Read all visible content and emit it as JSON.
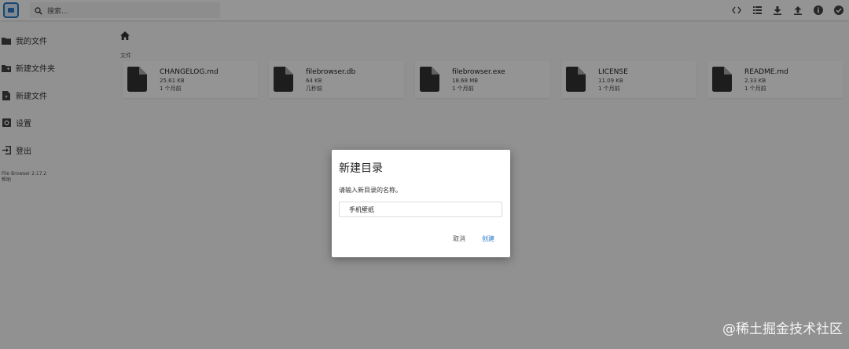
{
  "header": {
    "logo_icon": "file-browser-logo",
    "search_placeholder": "搜索...",
    "actions": [
      {
        "icon": "code-icon"
      },
      {
        "icon": "list-view-icon"
      },
      {
        "icon": "download-icon"
      },
      {
        "icon": "upload-icon"
      },
      {
        "icon": "info-icon"
      },
      {
        "icon": "select-check-icon"
      }
    ]
  },
  "sidebar": {
    "items": [
      {
        "label": "我的文件",
        "icon": "folder-icon"
      },
      {
        "label": "新建文件夹",
        "icon": "new-folder-icon"
      },
      {
        "label": "新建文件",
        "icon": "new-file-icon"
      },
      {
        "label": "设置",
        "icon": "settings-icon"
      },
      {
        "label": "登出",
        "icon": "logout-icon"
      }
    ],
    "credits": {
      "app": "File Browser 2.17.2",
      "help": "帮助"
    }
  },
  "main": {
    "home_icon": "home-icon",
    "files_label": "文件",
    "files": [
      {
        "name": "CHANGELOG.md",
        "size": "25.61 KB",
        "modified": "1 个月前"
      },
      {
        "name": "filebrowser.db",
        "size": "64 KB",
        "modified": "几秒前"
      },
      {
        "name": "filebrowser.exe",
        "size": "18.68 MB",
        "modified": "1 个月前"
      },
      {
        "name": "LICENSE",
        "size": "11.09 KB",
        "modified": "1 个月前"
      },
      {
        "name": "README.md",
        "size": "2.33 KB",
        "modified": "1 个月前"
      }
    ]
  },
  "dialog": {
    "title": "新建目录",
    "prompt": "请输入新目录的名称。",
    "input_value": "手机壁纸",
    "cancel_label": "取消",
    "create_label": "创建"
  },
  "watermark": "@稀土掘金技术社区",
  "colors": {
    "accent": "#2979c6",
    "overlay": "rgba(0,0,0,0.42)"
  }
}
